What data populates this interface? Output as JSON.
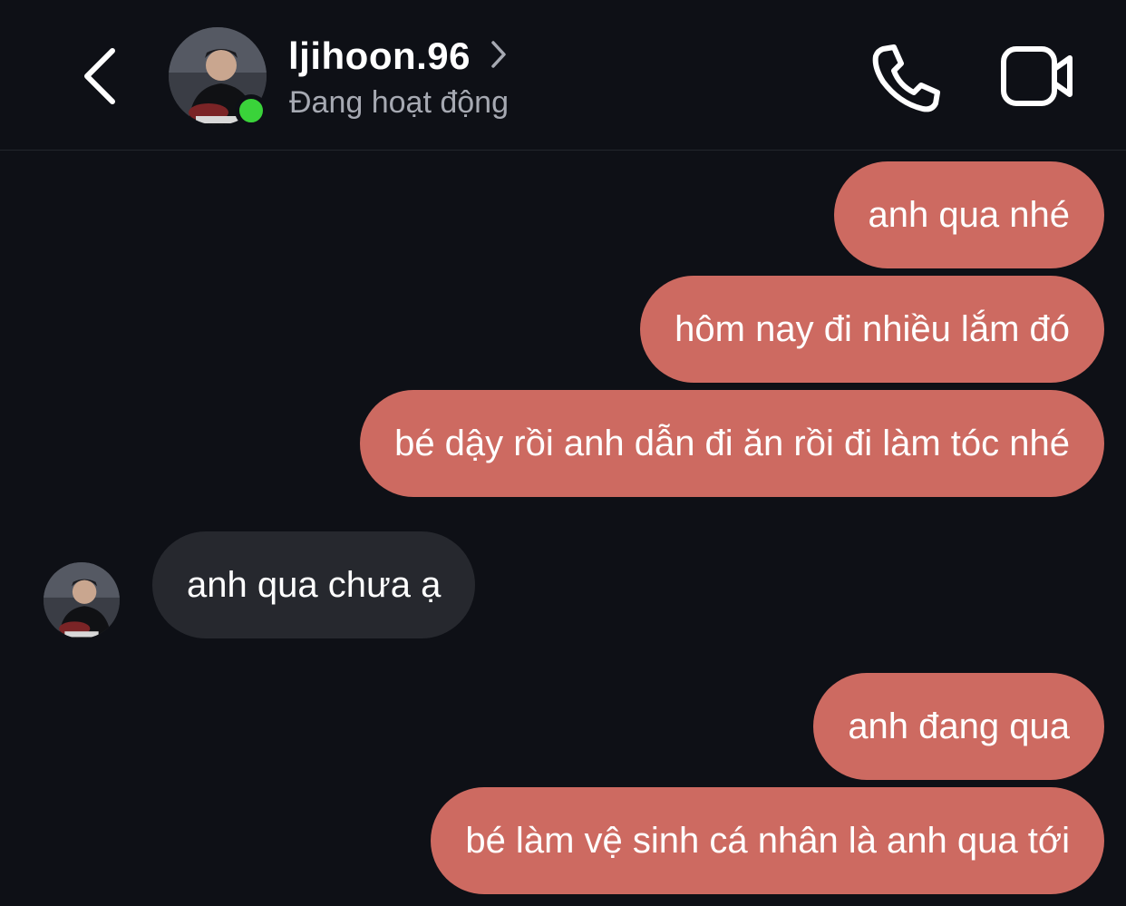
{
  "header": {
    "username": "ljihoon.96",
    "status": "Đang hoạt động",
    "icons": {
      "back": "chevron-left-icon",
      "profile_chevron": "chevron-right-icon",
      "call": "phone-icon",
      "video": "video-camera-icon"
    },
    "online_color": "#3ad33a"
  },
  "messages": [
    {
      "direction": "outgoing",
      "text": "anh qua nhé"
    },
    {
      "direction": "outgoing",
      "text": "hôm nay đi nhiều lắm đó"
    },
    {
      "direction": "outgoing",
      "text": "bé dậy rồi anh dẫn đi ăn rồi đi làm tóc nhé"
    },
    {
      "direction": "incoming",
      "text": "anh qua chưa ạ"
    },
    {
      "direction": "outgoing",
      "text": "anh đang qua"
    },
    {
      "direction": "outgoing",
      "text": "bé làm vệ sinh cá nhân là anh qua tới"
    }
  ],
  "colors": {
    "background": "#0e1016",
    "outgoing_bubble": "#cd6a61",
    "incoming_bubble": "#26282e",
    "status_text": "#a6a9b2"
  }
}
